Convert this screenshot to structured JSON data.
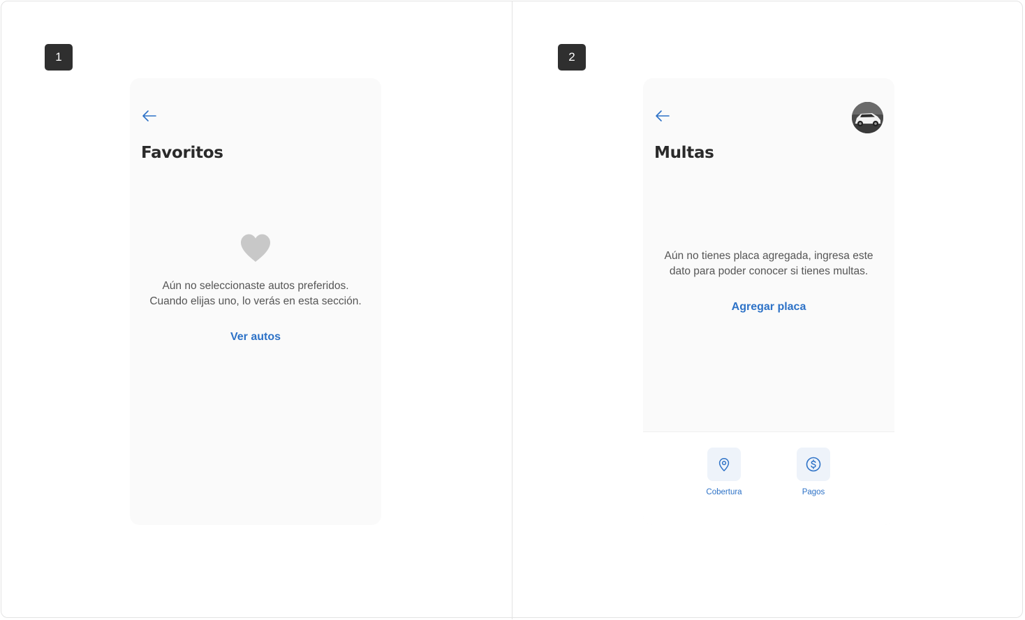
{
  "colors": {
    "accent": "#2d72c7",
    "title": "#2a2a2a",
    "body_text": "#555555",
    "heart": "#c8c8c8",
    "badge_bg": "#2f2f2f",
    "screen_bg": "#fafafa"
  },
  "screens": [
    {
      "badge": "1",
      "back_icon": "arrow-left-icon",
      "title": "Favoritos",
      "empty_icon": "heart-icon",
      "message_lines": [
        "Aún no seleccionaste autos preferidos.",
        "Cuando elijas uno, lo verás en esta sección."
      ],
      "action_label": "Ver autos"
    },
    {
      "badge": "2",
      "back_icon": "arrow-left-icon",
      "title": "Multas",
      "avatar": "car-avatar",
      "message_lines": [
        "Aún no tienes placa agregada, ingresa este",
        "dato para poder conocer si tienes multas."
      ],
      "action_label": "Agregar placa",
      "bottom_nav": [
        {
          "label": "Cobertura",
          "icon": "location-pin-icon"
        },
        {
          "label": "Pagos",
          "icon": "dollar-circle-icon"
        }
      ]
    }
  ]
}
